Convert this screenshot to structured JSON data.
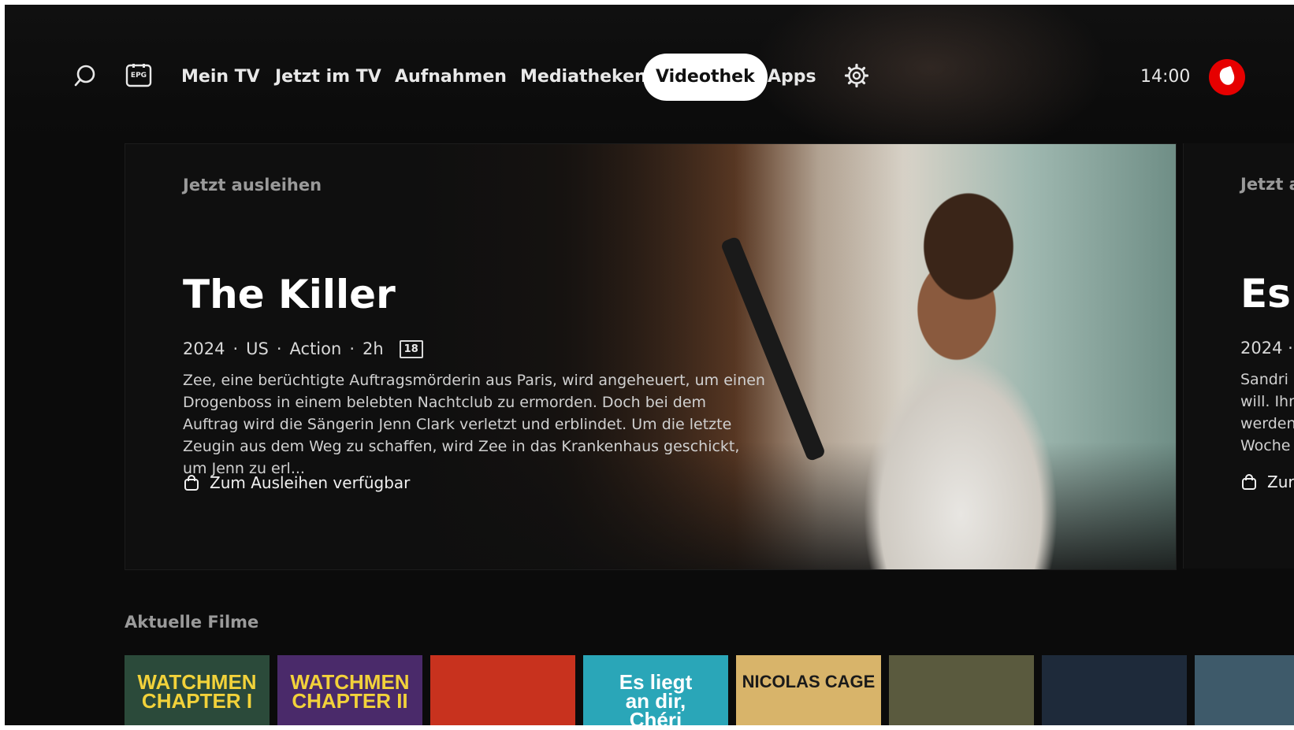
{
  "nav": {
    "items": [
      {
        "label": "Mein TV"
      },
      {
        "label": "Jetzt im TV"
      },
      {
        "label": "Aufnahmen"
      },
      {
        "label": "Mediatheken"
      },
      {
        "label": "Videothek",
        "active": true
      },
      {
        "label": "Apps"
      }
    ],
    "epg_label": "EPG",
    "clock": "14:00",
    "brand_color": "#e60000"
  },
  "hero": {
    "eyebrow": "Jetzt ausleihen",
    "title": "The Killer",
    "meta": {
      "year": "2024",
      "country": "US",
      "genre": "Action",
      "duration": "2h",
      "age": "18"
    },
    "description": "Zee, eine berüchtigte Auftragsmörderin aus Paris, wird angeheuert, um einen Drogenboss in einem belebten Nachtclub zu ermorden. Doch bei dem Auftrag wird die Sängerin Jenn Clark verletzt und erblindet. Um die letzte Zeugin aus dem Weg zu schaffen, wird Zee in das Krankenhaus geschickt, um Jenn zu erl...",
    "availability": "Zum Ausleihen verfügbar"
  },
  "hero_next": {
    "eyebrow": "Jetzt a",
    "title": "Es",
    "meta": "2024 ·",
    "description_lines": [
      "Sandri",
      "will. Ihr",
      "werden",
      "Woche"
    ],
    "availability": "Zur"
  },
  "row": {
    "title": "Aktuelle Filme",
    "tiles": [
      {
        "label": "WATCHMEN\nCHAPTER I",
        "bg": "#2b4a3a",
        "fg": "#f2d23a"
      },
      {
        "label": "WATCHMEN\nCHAPTER II",
        "bg": "#4a2a6a",
        "fg": "#f2d23a"
      },
      {
        "label": "",
        "bg": "#c8321e",
        "fg": "#ffffff"
      },
      {
        "label": "Es liegt\nan dir,\nChéri",
        "bg": "#2aa6b8",
        "fg": "#ffffff"
      },
      {
        "label": "NICOLAS CAGE",
        "bg": "#d8b46a",
        "fg": "#1a1a1a"
      },
      {
        "label": "",
        "bg": "#5a5a3e",
        "fg": "#ffffff"
      },
      {
        "label": "",
        "bg": "#1e2a3a",
        "fg": "#ffffff"
      },
      {
        "label": "",
        "bg": "#3e5a6a",
        "fg": "#ffffff"
      }
    ]
  }
}
